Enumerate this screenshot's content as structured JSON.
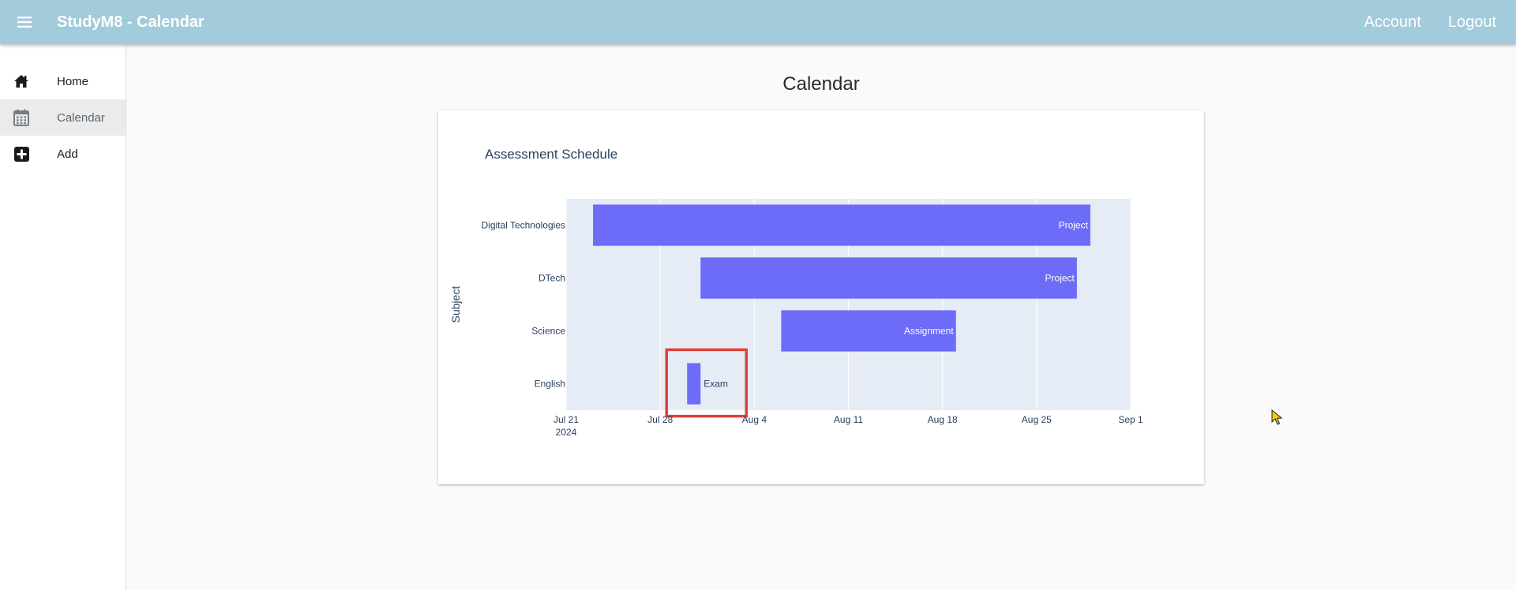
{
  "header": {
    "title": "StudyM8 - Calendar",
    "account_label": "Account",
    "logout_label": "Logout"
  },
  "sidebar": {
    "items": [
      {
        "label": "Home",
        "icon": "home-icon"
      },
      {
        "label": "Calendar",
        "icon": "calendar-icon",
        "active": true
      },
      {
        "label": "Add",
        "icon": "plus-square-icon"
      }
    ]
  },
  "main": {
    "heading": "Calendar"
  },
  "chart_data": {
    "type": "bar",
    "orientation": "horizontal-timeline",
    "title": "Assessment Schedule",
    "ylabel": "Subject",
    "xlabel": "",
    "bar_color": "#6c6cf8",
    "plot_bg": "#e5ecf6",
    "grid": true,
    "x_ticks": [
      "Jul 21",
      "Jul 28",
      "Aug 4",
      "Aug 11",
      "Aug 18",
      "Aug 25",
      "Sep 1"
    ],
    "x_tick_year": "2024",
    "xlim": [
      "2024-07-21",
      "2024-09-01"
    ],
    "categories": [
      "Digital Technologies",
      "DTech",
      "Science",
      "English"
    ],
    "tasks": [
      {
        "subject": "Digital Technologies",
        "start": "2024-07-23",
        "end": "2024-08-29",
        "label": "Project"
      },
      {
        "subject": "DTech",
        "start": "2024-07-31",
        "end": "2024-08-28",
        "label": "Project"
      },
      {
        "subject": "Science",
        "start": "2024-08-06",
        "end": "2024-08-19",
        "label": "Assignment"
      },
      {
        "subject": "English",
        "start": "2024-07-30",
        "end": "2024-07-31",
        "label": "Exam"
      }
    ],
    "highlighted_task": "Exam"
  }
}
